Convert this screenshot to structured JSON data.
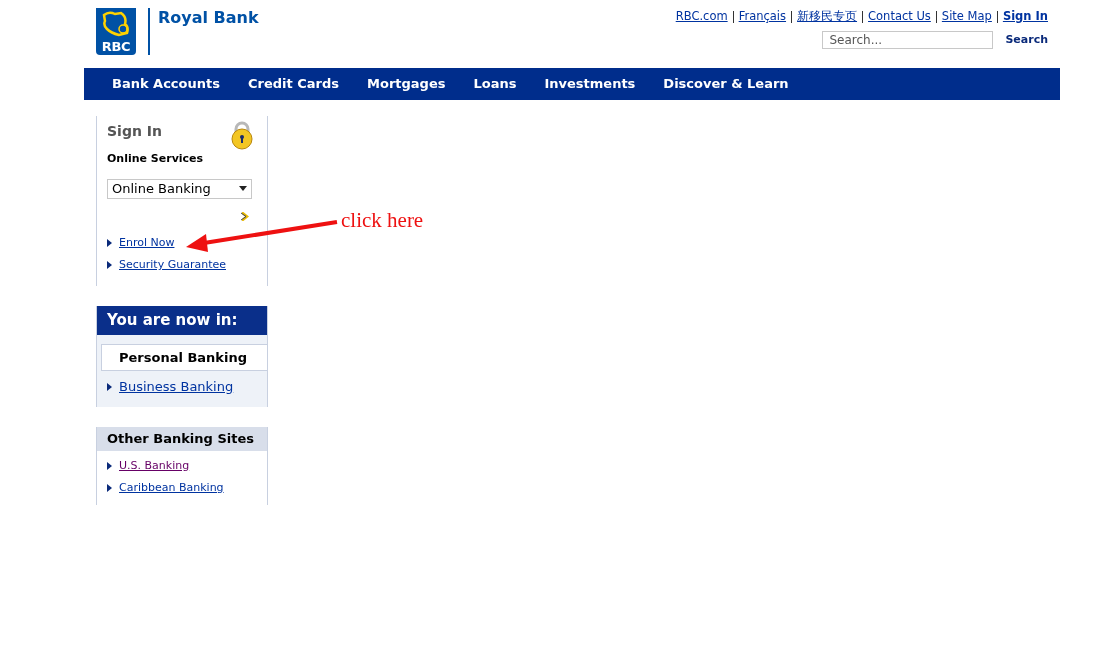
{
  "header": {
    "brand": "Royal Bank",
    "logo_text": "RBC",
    "top_links": [
      {
        "label": "RBC.com",
        "bold": false
      },
      {
        "label": "Français",
        "bold": false
      },
      {
        "label": "新移民专页",
        "bold": false
      },
      {
        "label": "Contact Us",
        "bold": false
      },
      {
        "label": "Site Map",
        "bold": false
      },
      {
        "label": "Sign In",
        "bold": true
      }
    ],
    "search": {
      "placeholder": "Search...",
      "button": "Search"
    }
  },
  "nav": [
    "Bank Accounts",
    "Credit Cards",
    "Mortgages",
    "Loans",
    "Investments",
    "Discover & Learn"
  ],
  "sign_in": {
    "title": "Sign In",
    "subtitle": "Online Services",
    "select_value": "Online Banking",
    "links": [
      {
        "label": "Enrol Now"
      },
      {
        "label": "Security Guarantee"
      }
    ]
  },
  "now_in": {
    "title": "You are now in:",
    "items": [
      {
        "label": "Personal Banking",
        "selected": true
      },
      {
        "label": "Business Banking",
        "selected": false
      }
    ]
  },
  "other_sites": {
    "title": "Other Banking Sites",
    "links": [
      {
        "label": "U.S. Banking",
        "visited": true
      },
      {
        "label": "Caribbean Banking",
        "visited": false
      }
    ]
  },
  "annotation": {
    "text": "click here"
  }
}
